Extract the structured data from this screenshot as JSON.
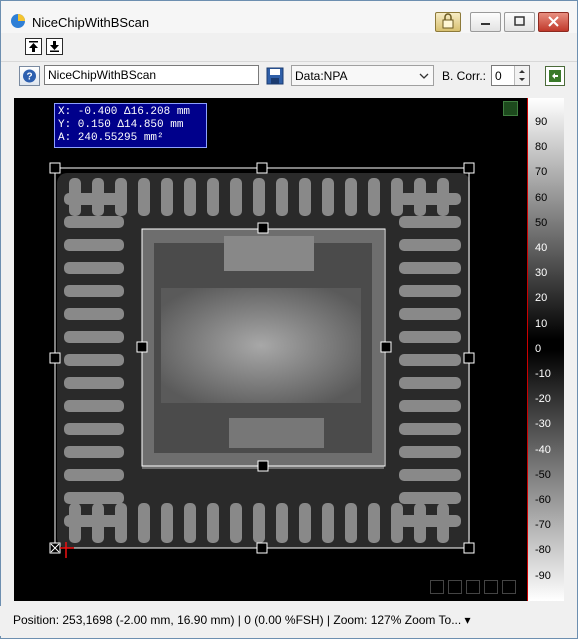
{
  "window": {
    "title": "NiceChipWithBScan"
  },
  "toolbar": {
    "name_value": "NiceChipWithBScan",
    "data_select_value": "Data:NPA",
    "bcorr_label": "B. Corr.:",
    "bcorr_value": "0"
  },
  "overlay": {
    "coords_line1": "X: -0.400 Δ16.208 mm",
    "coords_line2": "Y: 0.150 Δ14.850 mm",
    "coords_line3": "A: 240.55295 mm²"
  },
  "colorbar": {
    "ticks": [
      "90",
      "80",
      "70",
      "60",
      "50",
      "40",
      "30",
      "20",
      "10",
      "0",
      "-10",
      "-20",
      "-30",
      "-40",
      "-50",
      "-60",
      "-70",
      "-80",
      "-90"
    ]
  },
  "status": {
    "text": "Position: 253,1698 (-2.00 mm, 16.90 mm)  |  0 (0.00 %FSH)  |  Zoom: 127%  Zoom To... ▾"
  },
  "icons": {
    "app": "app-icon",
    "lock": "lock-icon",
    "minimize": "minimize-icon",
    "maximize": "maximize-icon",
    "close": "close-icon",
    "up": "arrow-up-icon",
    "down": "arrow-down-icon",
    "help": "help-icon",
    "save": "save-icon",
    "refresh": "refresh-icon"
  }
}
